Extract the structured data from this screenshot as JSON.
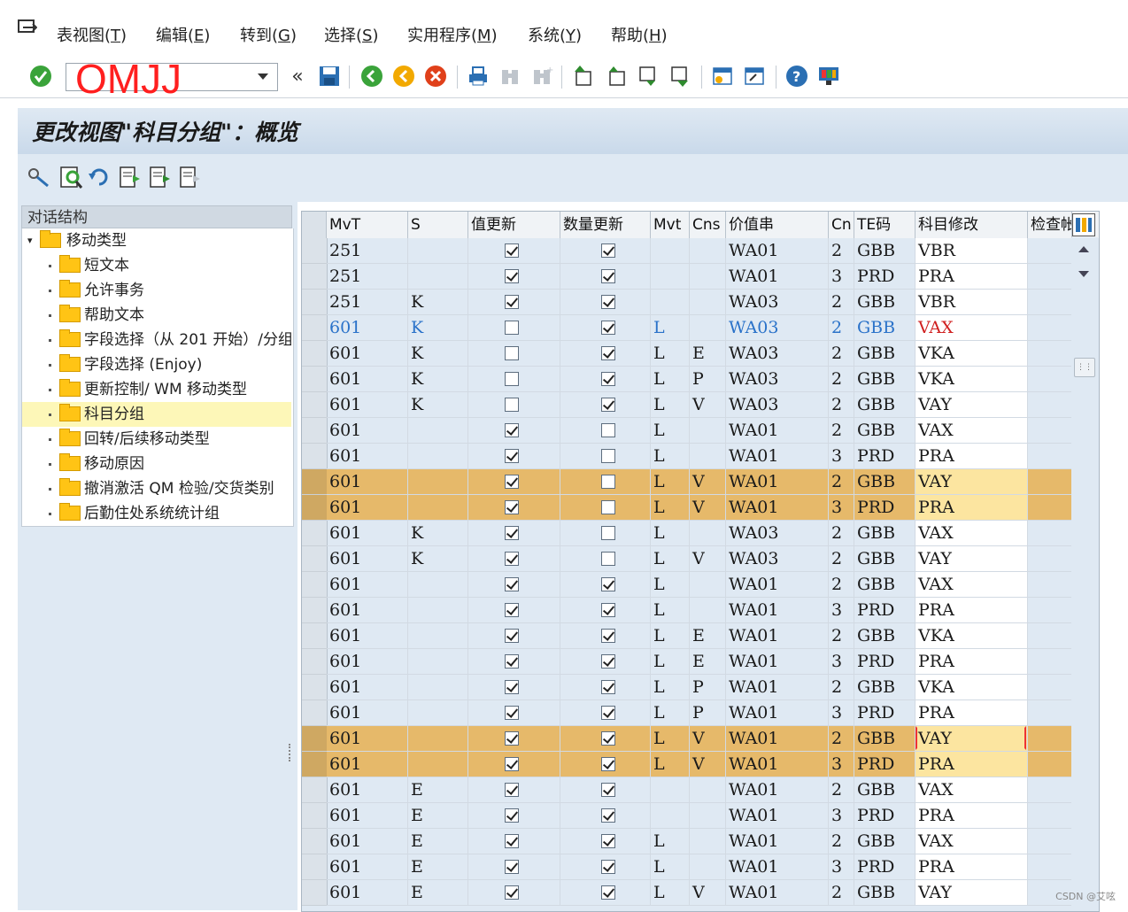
{
  "menubar": {
    "items": [
      {
        "label": "表视图(",
        "key": "T",
        "tail": ")"
      },
      {
        "label": "编辑(",
        "key": "E",
        "tail": ")"
      },
      {
        "label": "转到(",
        "key": "G",
        "tail": ")"
      },
      {
        "label": "选择(",
        "key": "S",
        "tail": ")"
      },
      {
        "label": "实用程序(",
        "key": "M",
        "tail": ")"
      },
      {
        "label": "系统(",
        "key": "Y",
        "tail": ")"
      },
      {
        "label": "帮助(",
        "key": "H",
        "tail": ")"
      }
    ]
  },
  "toolbar": {
    "command_value": "OMJJ",
    "icons": [
      "enter-icon",
      "back-double-icon",
      "save-icon",
      "back-icon",
      "exit-icon",
      "cancel-icon",
      "print-icon",
      "find-icon",
      "find-next-icon",
      "first-page-icon",
      "prev-page-icon",
      "next-page-icon",
      "last-page-icon",
      "new-session-icon",
      "shortcut-icon",
      "help-icon",
      "layout-icon"
    ]
  },
  "title": "更改视图\"科目分组\"：概览",
  "left_panel": {
    "header": "对话结构",
    "root": "移动类型",
    "children": [
      "短文本",
      "允许事务",
      "帮助文本",
      "字段选择（从 201 开始）/分组",
      "字段选择 (Enjoy)",
      "更新控制/ WM 移动类型",
      "科目分组",
      "回转/后续移动类型",
      "移动原因",
      "撤消激活 QM 检验/交货类别",
      "后勤住处系统统计组"
    ],
    "selected_index": 6
  },
  "table": {
    "headers": [
      "MvT",
      "S",
      "值更新",
      "数量更新",
      "Mvt",
      "Cns",
      "价值串",
      "Cn",
      "TE码",
      "科目修改",
      "检查帐"
    ],
    "rows": [
      {
        "mvt": "251",
        "s": "",
        "val": true,
        "qty": true,
        "mv": "",
        "cns": "",
        "vs": "WA01",
        "cn": "2",
        "te": "GBB",
        "acc": "VBR",
        "style": ""
      },
      {
        "mvt": "251",
        "s": "",
        "val": true,
        "qty": true,
        "mv": "",
        "cns": "",
        "vs": "WA01",
        "cn": "3",
        "te": "PRD",
        "acc": "PRA",
        "style": ""
      },
      {
        "mvt": "251",
        "s": "K",
        "val": true,
        "qty": true,
        "mv": "",
        "cns": "",
        "vs": "WA03",
        "cn": "2",
        "te": "GBB",
        "acc": "VBR",
        "style": ""
      },
      {
        "mvt": "601",
        "s": "K",
        "val": false,
        "qty": true,
        "mv": "L",
        "cns": "",
        "vs": "WA03",
        "cn": "2",
        "te": "GBB",
        "acc": "VAX",
        "style": "blue"
      },
      {
        "mvt": "601",
        "s": "K",
        "val": false,
        "qty": true,
        "mv": "L",
        "cns": "E",
        "vs": "WA03",
        "cn": "2",
        "te": "GBB",
        "acc": "VKA",
        "style": ""
      },
      {
        "mvt": "601",
        "s": "K",
        "val": false,
        "qty": true,
        "mv": "L",
        "cns": "P",
        "vs": "WA03",
        "cn": "2",
        "te": "GBB",
        "acc": "VKA",
        "style": ""
      },
      {
        "mvt": "601",
        "s": "K",
        "val": false,
        "qty": true,
        "mv": "L",
        "cns": "V",
        "vs": "WA03",
        "cn": "2",
        "te": "GBB",
        "acc": "VAY",
        "style": ""
      },
      {
        "mvt": "601",
        "s": "",
        "val": true,
        "qty": false,
        "mv": "L",
        "cns": "",
        "vs": "WA01",
        "cn": "2",
        "te": "GBB",
        "acc": "VAX",
        "style": ""
      },
      {
        "mvt": "601",
        "s": "",
        "val": true,
        "qty": false,
        "mv": "L",
        "cns": "",
        "vs": "WA01",
        "cn": "3",
        "te": "PRD",
        "acc": "PRA",
        "style": ""
      },
      {
        "mvt": "601",
        "s": "",
        "val": true,
        "qty": false,
        "mv": "L",
        "cns": "V",
        "vs": "WA01",
        "cn": "2",
        "te": "GBB",
        "acc": "VAY",
        "style": "hl"
      },
      {
        "mvt": "601",
        "s": "",
        "val": true,
        "qty": false,
        "mv": "L",
        "cns": "V",
        "vs": "WA01",
        "cn": "3",
        "te": "PRD",
        "acc": "PRA",
        "style": "hl"
      },
      {
        "mvt": "601",
        "s": "K",
        "val": true,
        "qty": false,
        "mv": "L",
        "cns": "",
        "vs": "WA03",
        "cn": "2",
        "te": "GBB",
        "acc": "VAX",
        "style": ""
      },
      {
        "mvt": "601",
        "s": "K",
        "val": true,
        "qty": false,
        "mv": "L",
        "cns": "V",
        "vs": "WA03",
        "cn": "2",
        "te": "GBB",
        "acc": "VAY",
        "style": ""
      },
      {
        "mvt": "601",
        "s": "",
        "val": true,
        "qty": true,
        "mv": "L",
        "cns": "",
        "vs": "WA01",
        "cn": "2",
        "te": "GBB",
        "acc": "VAX",
        "style": ""
      },
      {
        "mvt": "601",
        "s": "",
        "val": true,
        "qty": true,
        "mv": "L",
        "cns": "",
        "vs": "WA01",
        "cn": "3",
        "te": "PRD",
        "acc": "PRA",
        "style": ""
      },
      {
        "mvt": "601",
        "s": "",
        "val": true,
        "qty": true,
        "mv": "L",
        "cns": "E",
        "vs": "WA01",
        "cn": "2",
        "te": "GBB",
        "acc": "VKA",
        "style": ""
      },
      {
        "mvt": "601",
        "s": "",
        "val": true,
        "qty": true,
        "mv": "L",
        "cns": "E",
        "vs": "WA01",
        "cn": "3",
        "te": "PRD",
        "acc": "PRA",
        "style": ""
      },
      {
        "mvt": "601",
        "s": "",
        "val": true,
        "qty": true,
        "mv": "L",
        "cns": "P",
        "vs": "WA01",
        "cn": "2",
        "te": "GBB",
        "acc": "VKA",
        "style": ""
      },
      {
        "mvt": "601",
        "s": "",
        "val": true,
        "qty": true,
        "mv": "L",
        "cns": "P",
        "vs": "WA01",
        "cn": "3",
        "te": "PRD",
        "acc": "PRA",
        "style": ""
      },
      {
        "mvt": "601",
        "s": "",
        "val": true,
        "qty": true,
        "mv": "L",
        "cns": "V",
        "vs": "WA01",
        "cn": "2",
        "te": "GBB",
        "acc": "VAY",
        "style": "hl"
      },
      {
        "mvt": "601",
        "s": "",
        "val": true,
        "qty": true,
        "mv": "L",
        "cns": "V",
        "vs": "WA01",
        "cn": "3",
        "te": "PRD",
        "acc": "PRA",
        "style": "hl"
      },
      {
        "mvt": "601",
        "s": "E",
        "val": true,
        "qty": true,
        "mv": "",
        "cns": "",
        "vs": "WA01",
        "cn": "2",
        "te": "GBB",
        "acc": "VAX",
        "style": ""
      },
      {
        "mvt": "601",
        "s": "E",
        "val": true,
        "qty": true,
        "mv": "",
        "cns": "",
        "vs": "WA01",
        "cn": "3",
        "te": "PRD",
        "acc": "PRA",
        "style": ""
      },
      {
        "mvt": "601",
        "s": "E",
        "val": true,
        "qty": true,
        "mv": "L",
        "cns": "",
        "vs": "WA01",
        "cn": "2",
        "te": "GBB",
        "acc": "VAX",
        "style": ""
      },
      {
        "mvt": "601",
        "s": "E",
        "val": true,
        "qty": true,
        "mv": "L",
        "cns": "",
        "vs": "WA01",
        "cn": "3",
        "te": "PRD",
        "acc": "PRA",
        "style": ""
      },
      {
        "mvt": "601",
        "s": "E",
        "val": true,
        "qty": true,
        "mv": "L",
        "cns": "V",
        "vs": "WA01",
        "cn": "2",
        "te": "GBB",
        "acc": "VAY",
        "style": ""
      }
    ],
    "focused_row": 19
  },
  "watermark": "CSDN @艾呟",
  "colors": {
    "highlight": "#e6b96a",
    "editable_highlight": "#fce5a0",
    "link_blue": "#2a72c9",
    "error_red": "#d02020",
    "command_text": "#ff1f1f"
  }
}
